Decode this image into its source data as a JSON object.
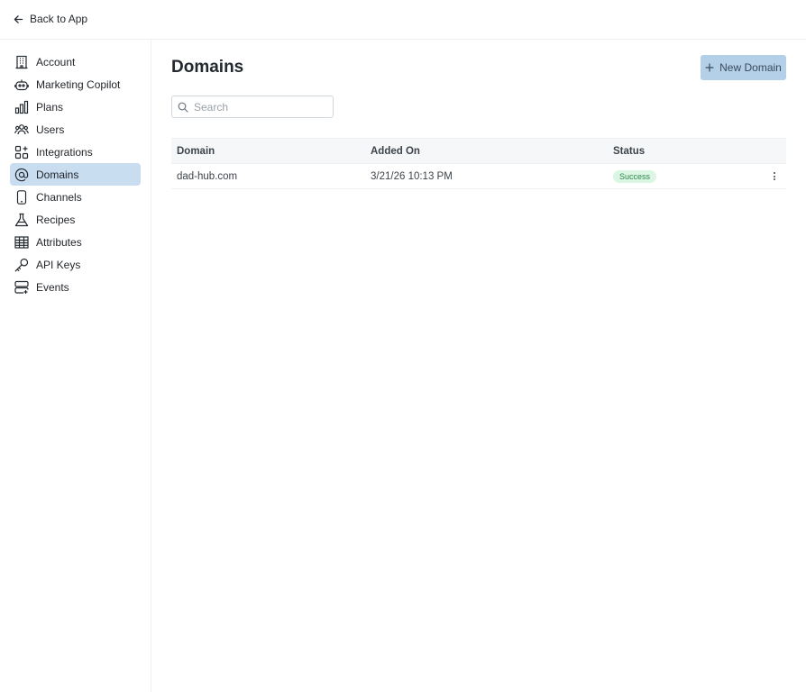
{
  "topbar": {
    "back_label": "Back to App"
  },
  "sidebar": {
    "items": [
      {
        "label": "Account",
        "icon": "building-icon",
        "active": false
      },
      {
        "label": "Marketing Copilot",
        "icon": "robot-icon",
        "active": false
      },
      {
        "label": "Plans",
        "icon": "bar-chart-icon",
        "active": false
      },
      {
        "label": "Users",
        "icon": "users-icon",
        "active": false
      },
      {
        "label": "Integrations",
        "icon": "integrations-icon",
        "active": false
      },
      {
        "label": "Domains",
        "icon": "at-sign-icon",
        "active": true
      },
      {
        "label": "Channels",
        "icon": "mobile-icon",
        "active": false
      },
      {
        "label": "Recipes",
        "icon": "flask-icon",
        "active": false
      },
      {
        "label": "Attributes",
        "icon": "table-icon",
        "active": false
      },
      {
        "label": "API Keys",
        "icon": "key-icon",
        "active": false
      },
      {
        "label": "Events",
        "icon": "server-events-icon",
        "active": false
      }
    ]
  },
  "main": {
    "title": "Domains",
    "new_button_label": "New Domain",
    "search": {
      "placeholder": "Search",
      "value": ""
    },
    "table": {
      "columns": [
        "Domain",
        "Added On",
        "Status"
      ],
      "rows": [
        {
          "domain": "dad-hub.com",
          "added_on": "3/21/26 10:13 PM",
          "status": "Success"
        }
      ]
    }
  },
  "colors": {
    "active_nav_bg": "#c9ddf0",
    "primary_button_bg": "#b4cfe8",
    "success_badge_bg": "#dcf5e4",
    "success_badge_text": "#2b8a4a"
  }
}
